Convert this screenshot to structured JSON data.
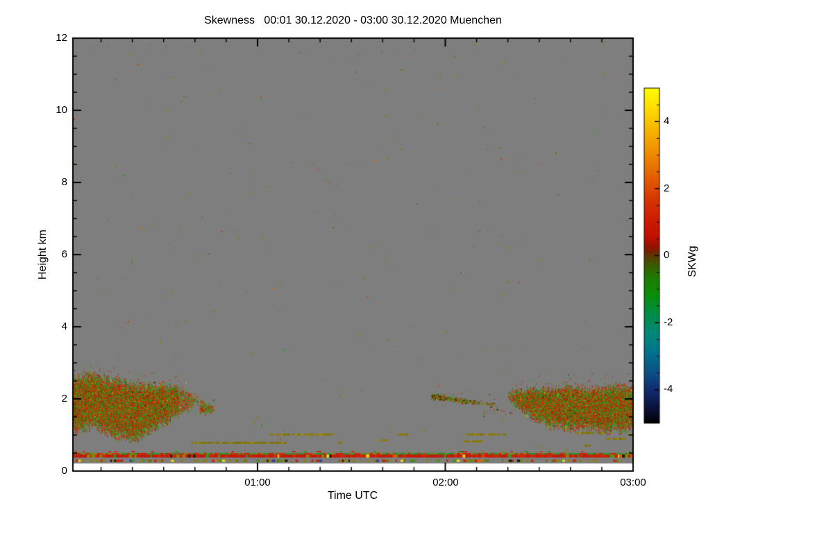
{
  "title": "Skewness   00:01 30.12.2020 - 03:00 30.12.2020 Muenchen",
  "axes": {
    "x": {
      "label": "Time UTC",
      "tick_labels": [
        "01:00",
        "02:00",
        "03:00"
      ]
    },
    "y": {
      "label": "Height km",
      "tick_labels": [
        "12",
        "10",
        "8",
        "6",
        "4",
        "2",
        "0"
      ]
    },
    "colorbar": {
      "label": "SKWg",
      "tick_labels": [
        "4",
        "2",
        "0",
        "-2",
        "-4"
      ]
    }
  },
  "colors": {
    "background": "#ffffff",
    "frame": "#000000",
    "no_signal_gray": "#7e7e7e",
    "accent_red": "#c81e00",
    "accent_green": "#2d961e",
    "accent_olive": "#8a7a00"
  },
  "chart_data": {
    "type": "heatmap",
    "title": "Skewness 00:01 30.12.2020 - 03:00 30.12.2020 Muenchen",
    "site": "Muenchen",
    "time_range_utc": [
      "00:01 30.12.2020",
      "03:00 30.12.2020"
    ],
    "xlabel": "Time UTC",
    "ylabel": "Height km",
    "x_axis": {
      "range_minutes": [
        1,
        180
      ],
      "major_ticks_minutes": [
        60,
        120,
        180
      ],
      "minor_step_minutes": 10
    },
    "y_axis": {
      "range_km": [
        0,
        12
      ],
      "major_ticks_km": [
        0,
        2,
        4,
        6,
        8,
        10,
        12
      ],
      "minor_step_km": 0.5
    },
    "colorbar": {
      "label": "SKWg",
      "range": [
        -5,
        5
      ],
      "major_ticks": [
        4,
        2,
        0,
        -2,
        -4
      ],
      "minor_step": 0.5,
      "stops": [
        [
          0,
          "#ffff00"
        ],
        [
          0.055,
          "#ffe000"
        ],
        [
          0.12,
          "#f8b800"
        ],
        [
          0.2,
          "#ee8800"
        ],
        [
          0.27,
          "#e25c00"
        ],
        [
          0.335,
          "#d63400"
        ],
        [
          0.4,
          "#cc1a00"
        ],
        [
          0.445,
          "#c01000"
        ],
        [
          0.47,
          "#981200"
        ],
        [
          0.49,
          "#702400"
        ],
        [
          0.505,
          "#544000"
        ],
        [
          0.53,
          "#3a5c00"
        ],
        [
          0.565,
          "#1e7c00"
        ],
        [
          0.615,
          "#0a8e06"
        ],
        [
          0.67,
          "#008c42"
        ],
        [
          0.73,
          "#008878"
        ],
        [
          0.79,
          "#00728c"
        ],
        [
          0.85,
          "#0c5086"
        ],
        [
          0.9,
          "#122c6e"
        ],
        [
          0.95,
          "#0c1440"
        ],
        [
          1,
          "#000000"
        ]
      ]
    },
    "background_field": {
      "color": "#7e7e7e",
      "height_km": [
        0.21,
        12
      ]
    },
    "palettes": {
      "cluster": [
        [
          "#c81e00",
          0.2
        ],
        [
          "#d23000",
          0.13
        ],
        [
          "#b41400",
          0.1
        ],
        [
          "#e04800",
          0.035
        ],
        [
          "#2d961e",
          0.17
        ],
        [
          "#1f8c14",
          0.13
        ],
        [
          "#3ca028",
          0.1
        ],
        [
          "#8c8200",
          0.085
        ],
        [
          "#6e6a00",
          0.04
        ],
        [
          "#f0dc00",
          0.005
        ],
        [
          "#101000",
          0.01
        ]
      ],
      "streak": [
        [
          "#8c8200",
          0.3
        ],
        [
          "#6e6a00",
          0.12
        ],
        [
          "#2d961e",
          0.2
        ],
        [
          "#c81e00",
          0.2
        ],
        [
          "#7a1000",
          0.08
        ],
        [
          "#101000",
          0.1
        ]
      ],
      "noise": [
        [
          "#8a7a00",
          0.55
        ],
        [
          "#6e6a00",
          0.12
        ],
        [
          "#2d961e",
          0.14
        ],
        [
          "#3ca028",
          0.06
        ],
        [
          "#c83c00",
          0.07
        ],
        [
          "#e06400",
          0.06
        ]
      ],
      "dash": [
        [
          "#8a7a00",
          0.6
        ],
        [
          "#79700a",
          0.25
        ],
        [
          "#9a8c00",
          0.15
        ]
      ],
      "mix": [
        [
          "#2d961e",
          0.3
        ],
        [
          "#1f8c14",
          0.12
        ],
        [
          "#c81e00",
          0.3
        ],
        [
          "#d23000",
          0.1
        ],
        [
          "#8c8200",
          0.18
        ]
      ],
      "redband": [
        [
          "#c81400",
          0.55
        ],
        [
          "#d22000",
          0.25
        ],
        [
          "#2d961e",
          0.05
        ],
        [
          "#8c8200",
          0.08
        ],
        [
          "#f0dc00",
          0.02
        ],
        [
          "#101000",
          0.02
        ],
        [
          "#e05000",
          0.03
        ]
      ],
      "sparse": [
        [
          "#8c8200",
          0.34
        ],
        [
          "#6e6a00",
          0.1
        ],
        [
          "#2d961e",
          0.2
        ],
        [
          "#c81e00",
          0.2
        ],
        [
          "#283c96",
          0.05
        ],
        [
          "#f0dc00",
          0.04
        ],
        [
          "#101000",
          0.04
        ],
        [
          "#e06400",
          0.03
        ]
      ]
    },
    "noise_specks": {
      "count": 270,
      "palette": "noise",
      "height_range_km": [
        0.25,
        11.9
      ]
    },
    "speckle_regions": [
      {
        "name": "left-cloud-cluster",
        "t": [
          1,
          41
        ],
        "top": [
          2.65,
          2.7,
          2.55,
          2.45,
          2.42,
          2.32,
          2.05
        ],
        "bottom": [
          1.1,
          1.25,
          0.92,
          0.88,
          1.22,
          1.58,
          1.88
        ],
        "coverage": 0.92,
        "jitter": 0.22,
        "palette": "cluster",
        "flecks": 0.28,
        "fade_out": 0.16
      },
      {
        "name": "left-cluster-tip",
        "t": [
          41.5,
          46
        ],
        "top": [
          1.98,
          1.9,
          1.78
        ],
        "bottom": [
          1.6,
          1.62,
          1.66
        ],
        "coverage": 0.5,
        "jitter": 0.1,
        "palette": "cluster",
        "flecks": 0.05
      },
      {
        "name": "descending-streak",
        "t": [
          115.5,
          135.5
        ],
        "top": [
          2.17,
          2.1,
          2.02,
          1.95,
          1.88
        ],
        "bottom": [
          2.0,
          1.96,
          1.9,
          1.86,
          1.8
        ],
        "coverage": 0.62,
        "jitter": 0.05,
        "palette": "streak",
        "flecks": 0.1,
        "fade_out": 0.3
      },
      {
        "name": "mid-scatter",
        "t": [
          132,
          141
        ],
        "top": [
          1.85,
          1.8,
          1.78
        ],
        "bottom": [
          1.5,
          1.55,
          1.6
        ],
        "coverage": 0.05,
        "jitter": 0.1,
        "palette": "streak"
      },
      {
        "name": "right-cloud-cluster",
        "t": [
          140,
          180
        ],
        "top": [
          2.2,
          2.28,
          2.3,
          2.36,
          2.32,
          2.38,
          2.3
        ],
        "bottom": [
          2.0,
          1.55,
          1.25,
          1.18,
          1.22,
          1.1,
          1.15
        ],
        "coverage": 0.92,
        "jitter": 0.22,
        "palette": "cluster",
        "flecks": 0.22,
        "fade_in": 0.05
      }
    ],
    "dash_lines": {
      "palette": "dash",
      "thickness_km": 0.055,
      "segments_t1_t2_h": [
        [
          38.7,
          44.3,
          0.81
        ],
        [
          44.9,
          46.1,
          0.81
        ],
        [
          46.5,
          68.7,
          0.81
        ],
        [
          63.8,
          64.9,
          1.04
        ],
        [
          65.9,
          67.2,
          1.04
        ],
        [
          67.6,
          83.7,
          1.04
        ],
        [
          85.7,
          87.0,
          0.81
        ],
        [
          98.2,
          101.3,
          0.88
        ],
        [
          104.8,
          107.9,
          1.04
        ],
        [
          125.9,
          131.4,
          0.85
        ],
        [
          125.9,
          135.9,
          1.04
        ],
        [
          136.8,
          139.0,
          1.04
        ],
        [
          161.5,
          167.8,
          1.08
        ],
        [
          168.6,
          170.3,
          1.08
        ],
        [
          171.5,
          178.0,
          0.92
        ],
        [
          164.5,
          166.2,
          0.73
        ],
        [
          177.5,
          180,
          1.04
        ]
      ]
    },
    "ground_bands": [
      {
        "h": [
          0.52,
          0.555
        ],
        "palette": "mix",
        "coverage": 0.12
      },
      {
        "h": [
          0.455,
          0.5
        ],
        "palette": "mix",
        "coverage": 1
      },
      {
        "h": [
          0.375,
          0.455
        ],
        "palette": "redband",
        "coverage": 1
      },
      {
        "h": [
          0.255,
          0.315
        ],
        "palette": "sparse",
        "coverage": 0.55
      }
    ]
  }
}
